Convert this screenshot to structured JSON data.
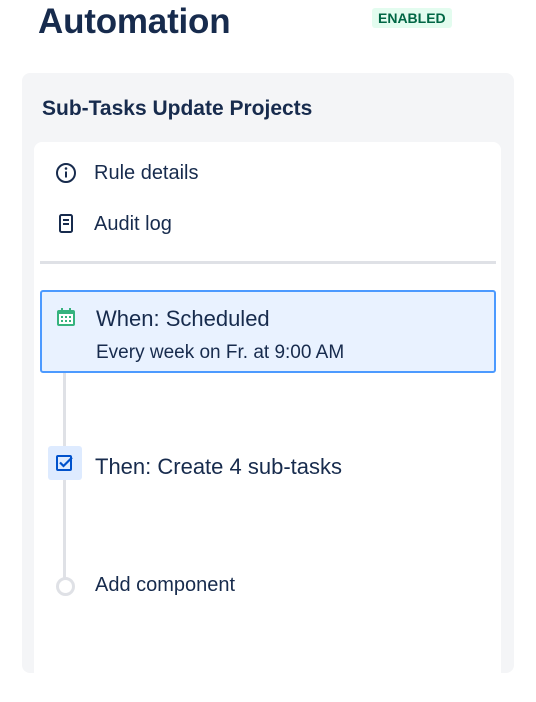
{
  "header": {
    "title": "Automation",
    "status_badge": "ENABLED"
  },
  "rule": {
    "name": "Sub-Tasks Update Projects",
    "menu": [
      {
        "label": "Rule details",
        "icon": "info-icon"
      },
      {
        "label": "Audit log",
        "icon": "audit-log-icon"
      }
    ],
    "trigger": {
      "title": "When: Scheduled",
      "subtitle": "Every week on Fr. at 9:00 AM",
      "icon": "calendar-icon"
    },
    "action": {
      "label": "Then: Create 4 sub-tasks",
      "icon": "checkbox-icon"
    },
    "add_component_label": "Add component"
  },
  "colors": {
    "badge_bg": "#e3fcef",
    "badge_text": "#006644",
    "trigger_bg": "#e9f2ff",
    "trigger_border": "#4c9aff",
    "panel_bg": "#f4f5f7"
  }
}
